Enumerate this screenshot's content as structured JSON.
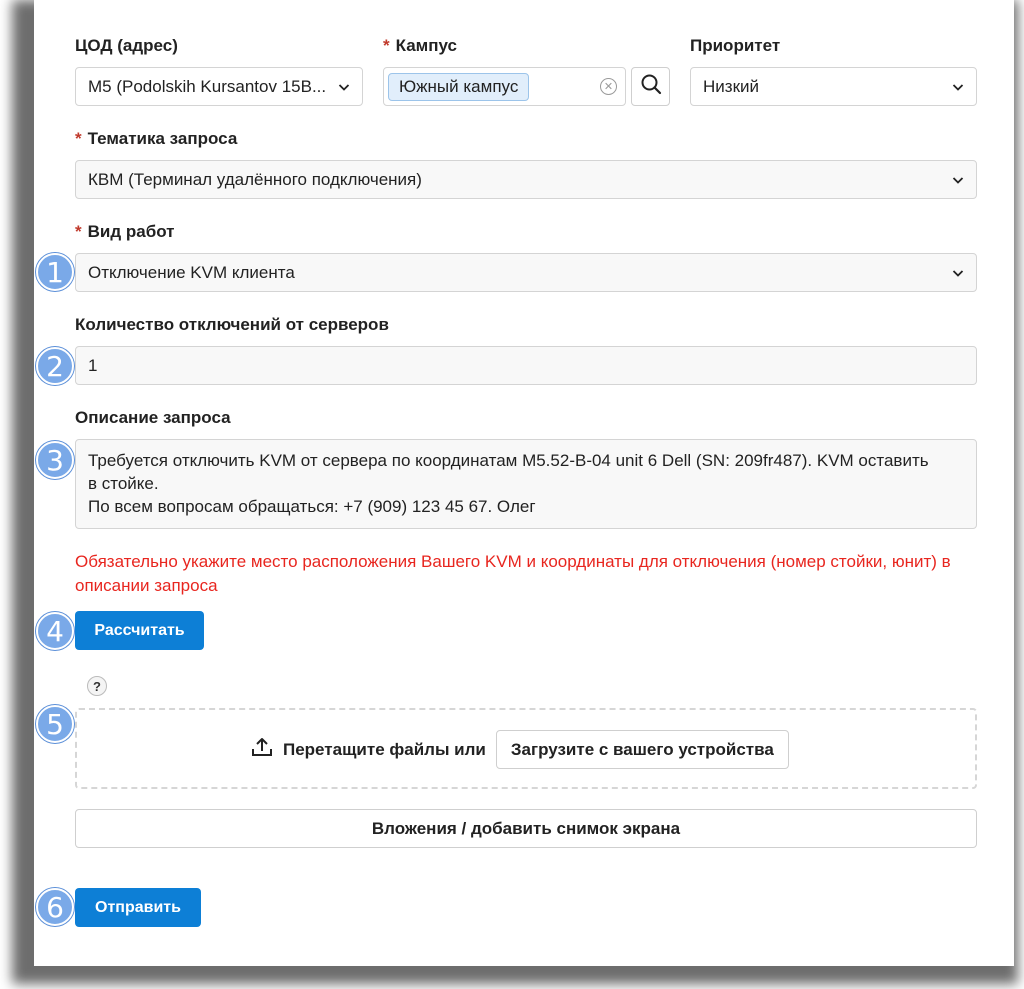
{
  "form": {
    "cod": {
      "label": "ЦОД (адрес)",
      "value": "M5 (Podolskih Kursantov 15B..."
    },
    "campus": {
      "label": "Кампус",
      "tag": "Южный кампус"
    },
    "priority": {
      "label": "Приоритет",
      "value": "Низкий"
    },
    "topic": {
      "label": "Тематика запроса",
      "value": "КВМ (Терминал удалённого подключения)"
    },
    "work_type": {
      "label": "Вид работ",
      "value": "Отключение KVM клиента"
    },
    "count": {
      "label": "Количество отключений от серверов",
      "value": "1"
    },
    "description": {
      "label": "Описание запроса",
      "lines": [
        "Требуется отключить KVM от сервера по координатам M5.52-B-04 unit 6 Dell (SN: 209fr487). KVM оставить",
        "в стойке.",
        "По всем вопросам обращаться: +7 (909) 123 45 67. Олег"
      ]
    },
    "warning": "Обязательно укажите место расположения Вашего KVM и координаты для отключения (номер стойки, юнит) в описании запроса",
    "calc_button": "Рассчитать",
    "help_mark": "?",
    "dropzone": {
      "text": "Перетащите файлы или",
      "upload_button": "Загрузите с вашего устройства"
    },
    "attachments_button": "Вложения / добавить снимок экрана",
    "submit_button": "Отправить",
    "required_mark": "*"
  },
  "badges": [
    "1",
    "2",
    "3",
    "4",
    "5",
    "6"
  ],
  "colors": {
    "primary": "#0d7fd6",
    "warning": "#e8261f",
    "badge": "#7aa9e8",
    "required": "#c0392b"
  },
  "icons": [
    "chevron-down-icon",
    "clear-icon",
    "search-icon",
    "upload-icon"
  ]
}
